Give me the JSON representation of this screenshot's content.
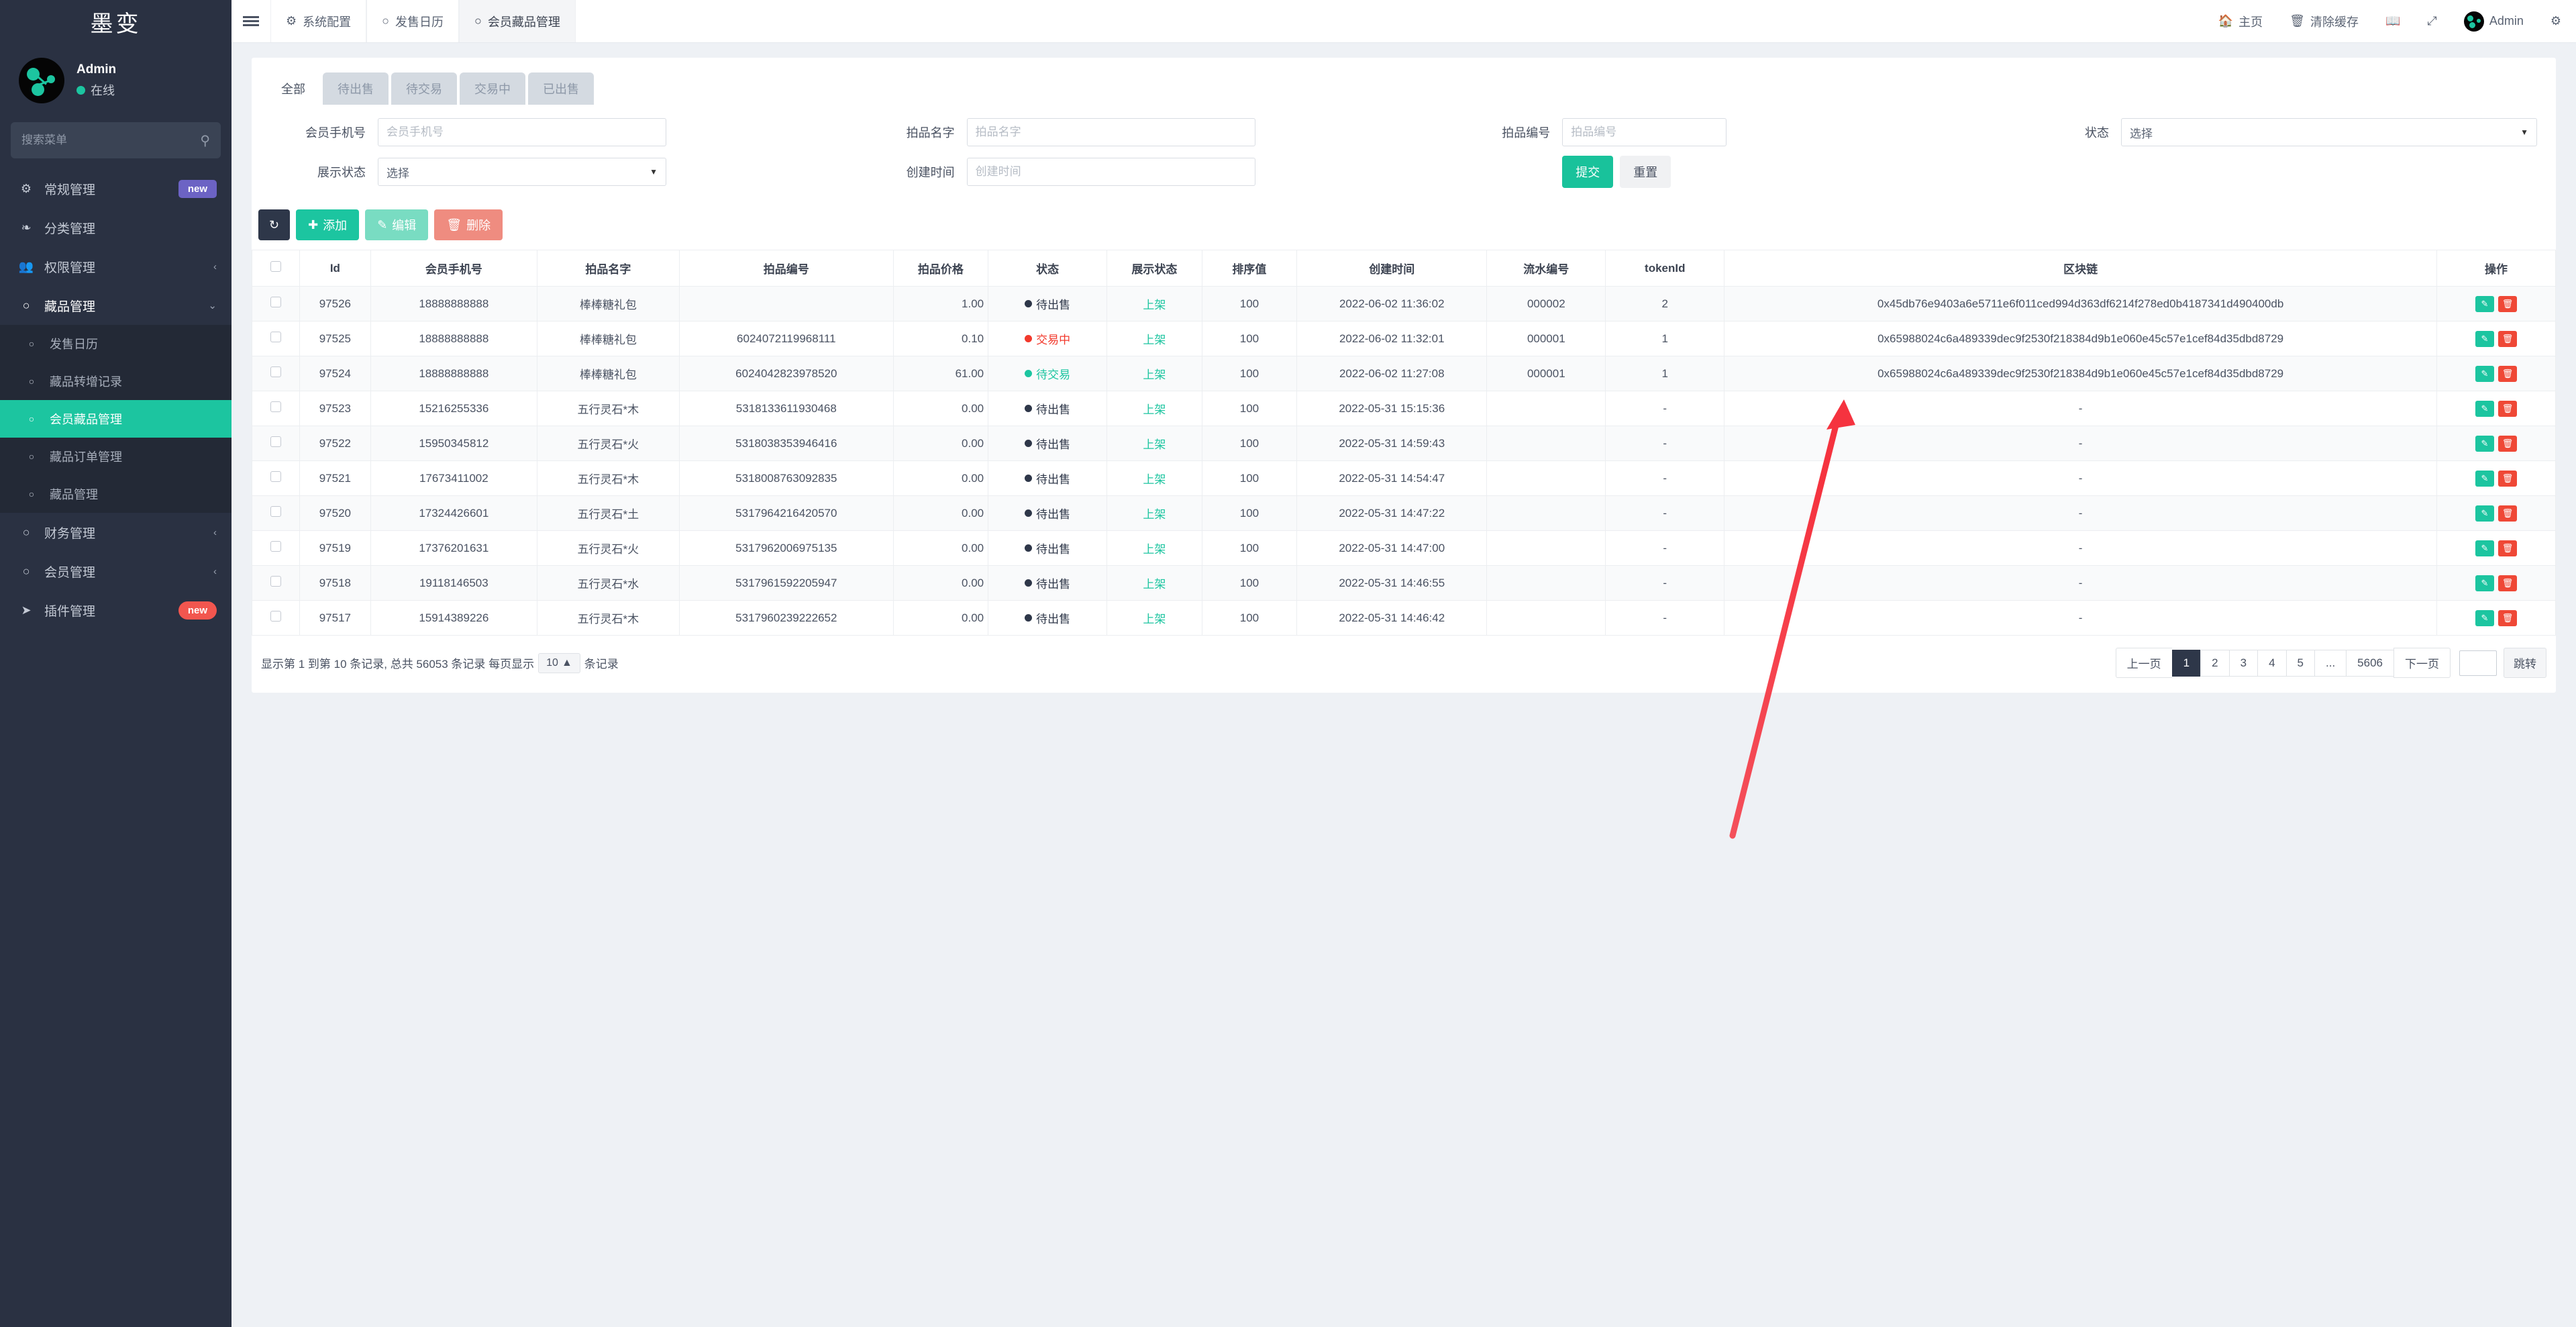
{
  "sidebar": {
    "brand": "墨变",
    "profile": {
      "name": "Admin",
      "status": "在线"
    },
    "search": {
      "placeholder": "搜索菜单",
      "value": "",
      "icon": "search-icon"
    },
    "items": [
      {
        "label": "常规管理",
        "icon": "gears-icon",
        "badge": "new",
        "badge_style": "purple",
        "chevron": "",
        "level": "top"
      },
      {
        "label": "分类管理",
        "icon": "leaf-icon",
        "badge": "",
        "badge_style": "",
        "chevron": "",
        "level": "top"
      },
      {
        "label": "权限管理",
        "icon": "users-icon",
        "badge": "",
        "badge_style": "",
        "chevron": "‹",
        "level": "top"
      },
      {
        "label": "藏品管理",
        "icon": "circle-icon",
        "badge": "",
        "badge_style": "",
        "chevron": "⌄",
        "level": "top-open"
      },
      {
        "label": "发售日历",
        "icon": "circle-icon",
        "badge": "",
        "badge_style": "",
        "chevron": "",
        "level": "sub"
      },
      {
        "label": "藏品转增记录",
        "icon": "circle-icon",
        "badge": "",
        "badge_style": "",
        "chevron": "",
        "level": "sub"
      },
      {
        "label": "会员藏品管理",
        "icon": "circle-icon",
        "badge": "",
        "badge_style": "",
        "chevron": "",
        "level": "sub-active"
      },
      {
        "label": "藏品订单管理",
        "icon": "circle-icon",
        "badge": "",
        "badge_style": "",
        "chevron": "",
        "level": "sub"
      },
      {
        "label": "藏品管理",
        "icon": "circle-icon",
        "badge": "",
        "badge_style": "",
        "chevron": "",
        "level": "sub"
      },
      {
        "label": "财务管理",
        "icon": "circle-icon",
        "badge": "",
        "badge_style": "",
        "chevron": "‹",
        "level": "top"
      },
      {
        "label": "会员管理",
        "icon": "circle-icon",
        "badge": "",
        "badge_style": "",
        "chevron": "‹",
        "level": "top"
      },
      {
        "label": "插件管理",
        "icon": "rocket-icon",
        "badge": "new",
        "badge_style": "red",
        "chevron": "",
        "level": "top"
      }
    ]
  },
  "topbar": {
    "menu_icon": "hamburger-icon",
    "tabs": [
      {
        "label": "系统配置",
        "icon": "gear-icon",
        "selected": false
      },
      {
        "label": "发售日历",
        "icon": "circle-icon",
        "selected": false
      },
      {
        "label": "会员藏品管理",
        "icon": "circle-icon",
        "selected": true
      }
    ],
    "actions": [
      {
        "label": "主页",
        "icon": "home-icon"
      },
      {
        "label": "清除缓存",
        "icon": "trash-icon"
      },
      {
        "label": "",
        "icon": "book-icon"
      },
      {
        "label": "",
        "icon": "fullscreen-icon"
      }
    ],
    "user": "Admin",
    "settings_icon": "gears-icon"
  },
  "tabs": [
    {
      "label": "全部",
      "active": true
    },
    {
      "label": "待出售",
      "active": false
    },
    {
      "label": "待交易",
      "active": false
    },
    {
      "label": "交易中",
      "active": false
    },
    {
      "label": "已出售",
      "active": false
    }
  ],
  "filter": {
    "member_phone": {
      "label": "会员手机号",
      "placeholder": "会员手机号",
      "value": ""
    },
    "item_name": {
      "label": "拍品名字",
      "placeholder": "拍品名字",
      "value": ""
    },
    "item_no": {
      "label": "拍品编号",
      "placeholder": "拍品编号",
      "value": ""
    },
    "status": {
      "label": "状态",
      "value": "选择"
    },
    "display_status": {
      "label": "展示状态",
      "value": "选择"
    },
    "create_time": {
      "label": "创建时间",
      "placeholder": "创建时间",
      "value": ""
    },
    "submit_label": "提交",
    "reset_label": "重置"
  },
  "toolbar": {
    "refresh_icon": "refresh-icon",
    "add_label": "添加",
    "edit_label": "编辑",
    "delete_label": "删除"
  },
  "table": {
    "columns": [
      "",
      "Id",
      "会员手机号",
      "拍品名字",
      "拍品编号",
      "拍品价格",
      "状态",
      "展示状态",
      "排序值",
      "创建时间",
      "流水编号",
      "tokenId",
      "区块链",
      "操作"
    ],
    "rows": [
      {
        "id": "97526",
        "phone": "18888888888",
        "name": "棒棒糖礼包",
        "no": "",
        "price": "1.00",
        "status": "待出售",
        "status_color": "#2e3749",
        "display": "上架",
        "sort": "100",
        "created": "2022-06-02 11:36:02",
        "serial": "000002",
        "token": "2",
        "chain": "0x45db76e9403a6e5711e6f011ced994d363df6214f278ed0b4187341d490400db"
      },
      {
        "id": "97525",
        "phone": "18888888888",
        "name": "棒棒糖礼包",
        "no": "6024072119968111",
        "price": "0.10",
        "status": "交易中",
        "status_color": "#f2392c",
        "display": "上架",
        "sort": "100",
        "created": "2022-06-02 11:32:01",
        "serial": "000001",
        "token": "1",
        "chain": "0x65988024c6a489339dec9f2530f218384d9b1e060e45c57e1cef84d35dbd8729"
      },
      {
        "id": "97524",
        "phone": "18888888888",
        "name": "棒棒糖礼包",
        "no": "6024042823978520",
        "price": "61.00",
        "status": "待交易",
        "status_color": "#1cc5a0",
        "display": "上架",
        "sort": "100",
        "created": "2022-06-02 11:27:08",
        "serial": "000001",
        "token": "1",
        "chain": "0x65988024c6a489339dec9f2530f218384d9b1e060e45c57e1cef84d35dbd8729"
      },
      {
        "id": "97523",
        "phone": "15216255336",
        "name": "五行灵石*木",
        "no": "5318133611930468",
        "price": "0.00",
        "status": "待出售",
        "status_color": "#2e3749",
        "display": "上架",
        "sort": "100",
        "created": "2022-05-31 15:15:36",
        "serial": "",
        "token": "-",
        "chain": "-"
      },
      {
        "id": "97522",
        "phone": "15950345812",
        "name": "五行灵石*火",
        "no": "5318038353946416",
        "price": "0.00",
        "status": "待出售",
        "status_color": "#2e3749",
        "display": "上架",
        "sort": "100",
        "created": "2022-05-31 14:59:43",
        "serial": "",
        "token": "-",
        "chain": "-"
      },
      {
        "id": "97521",
        "phone": "17673411002",
        "name": "五行灵石*木",
        "no": "5318008763092835",
        "price": "0.00",
        "status": "待出售",
        "status_color": "#2e3749",
        "display": "上架",
        "sort": "100",
        "created": "2022-05-31 14:54:47",
        "serial": "",
        "token": "-",
        "chain": "-"
      },
      {
        "id": "97520",
        "phone": "17324426601",
        "name": "五行灵石*土",
        "no": "5317964216420570",
        "price": "0.00",
        "status": "待出售",
        "status_color": "#2e3749",
        "display": "上架",
        "sort": "100",
        "created": "2022-05-31 14:47:22",
        "serial": "",
        "token": "-",
        "chain": "-"
      },
      {
        "id": "97519",
        "phone": "17376201631",
        "name": "五行灵石*火",
        "no": "5317962006975135",
        "price": "0.00",
        "status": "待出售",
        "status_color": "#2e3749",
        "display": "上架",
        "sort": "100",
        "created": "2022-05-31 14:47:00",
        "serial": "",
        "token": "-",
        "chain": "-"
      },
      {
        "id": "97518",
        "phone": "19118146503",
        "name": "五行灵石*水",
        "no": "5317961592205947",
        "price": "0.00",
        "status": "待出售",
        "status_color": "#2e3749",
        "display": "上架",
        "sort": "100",
        "created": "2022-05-31 14:46:55",
        "serial": "",
        "token": "-",
        "chain": "-"
      },
      {
        "id": "97517",
        "phone": "15914389226",
        "name": "五行灵石*木",
        "no": "5317960239222652",
        "price": "0.00",
        "status": "待出售",
        "status_color": "#2e3749",
        "display": "上架",
        "sort": "100",
        "created": "2022-05-31 14:46:42",
        "serial": "",
        "token": "-",
        "chain": "-"
      }
    ]
  },
  "footer": {
    "info_prefix": "显示第 1 到第 10 条记录, 总共 56053 条记录 每页显示",
    "page_size": "10",
    "info_suffix": "条记录",
    "prev": "上一页",
    "pages": [
      "1",
      "2",
      "3",
      "4",
      "5",
      "...",
      "5606"
    ],
    "current_page": "1",
    "next": "下一页",
    "jump_value": "",
    "jump_label": "跳转"
  },
  "annotation": {
    "type": "red-arrow",
    "color": "#f5333f"
  }
}
